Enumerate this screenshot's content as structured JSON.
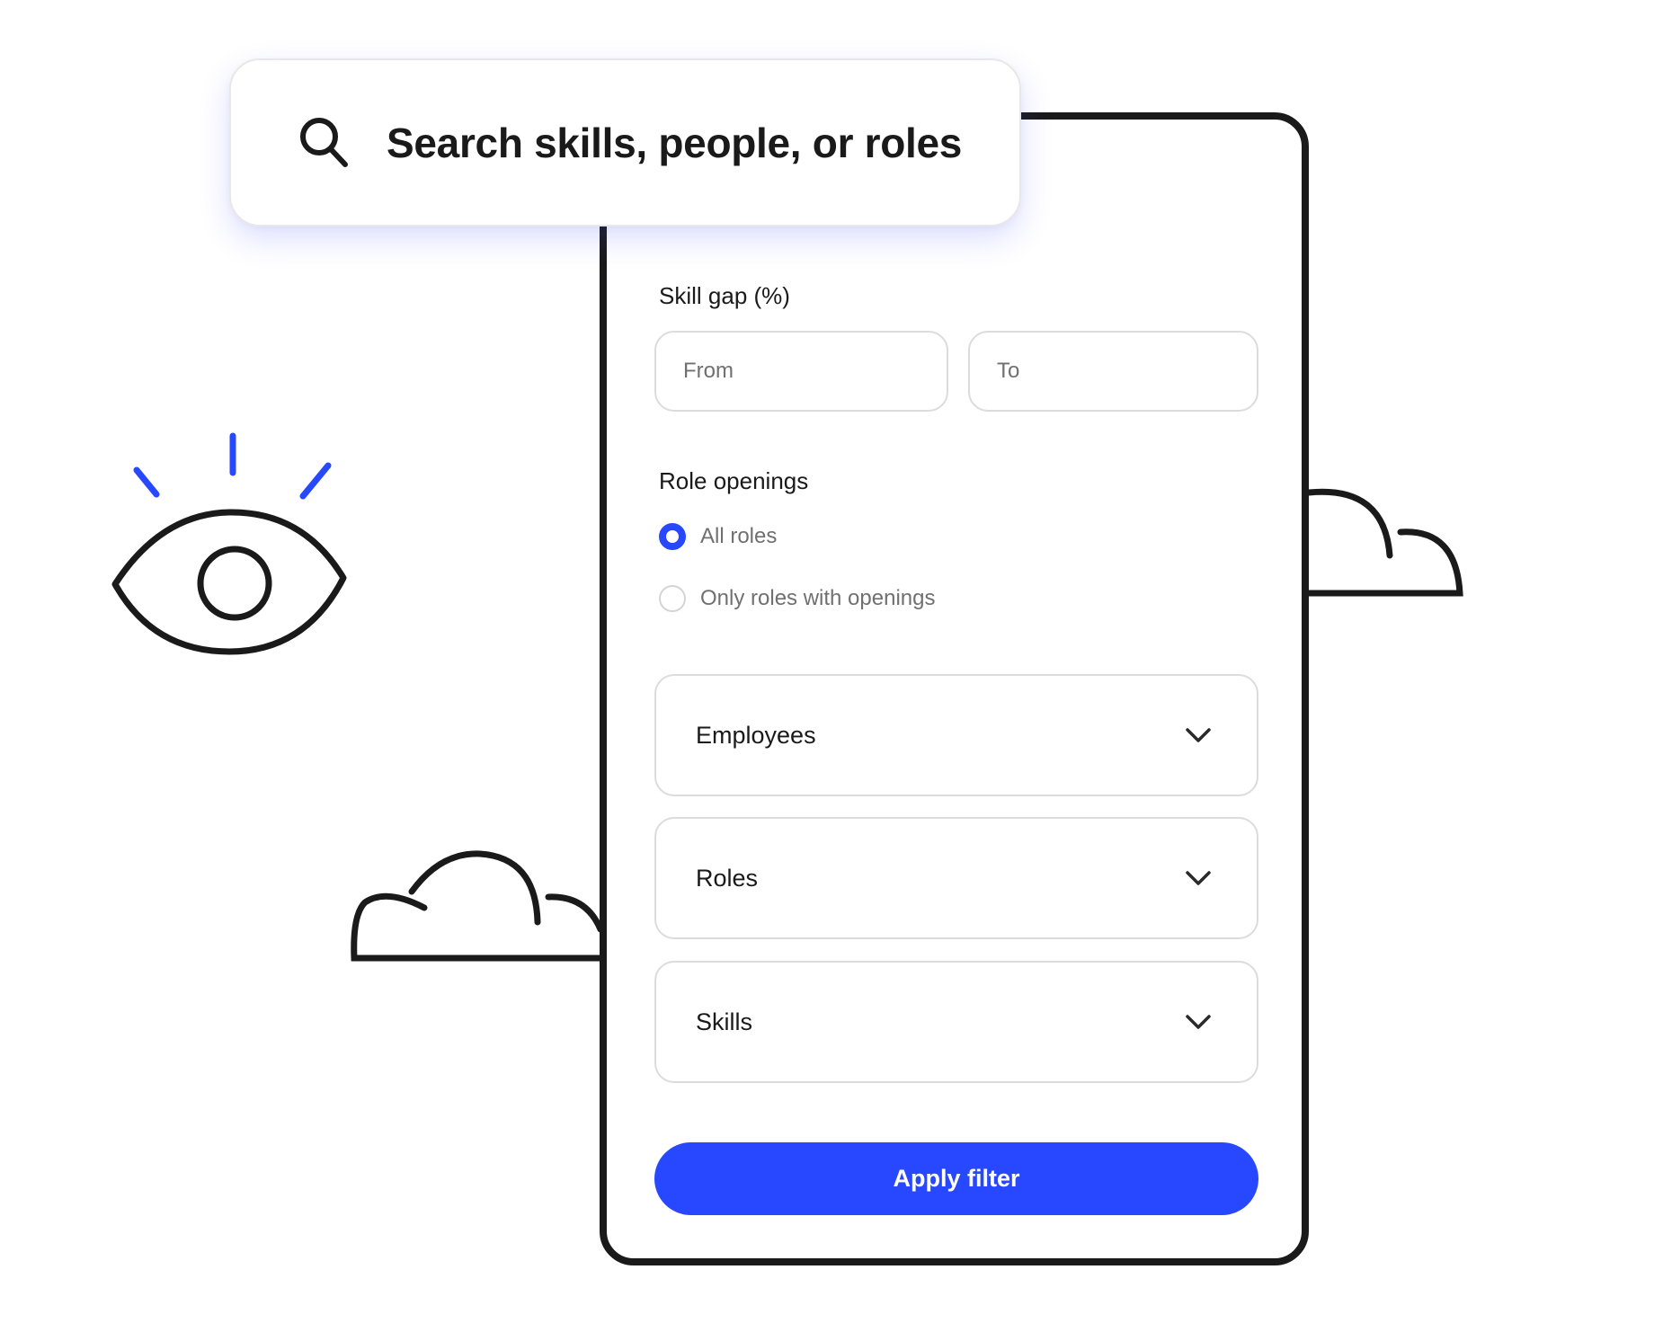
{
  "search": {
    "placeholder": "Search skills, people, or roles",
    "icon": "search-icon"
  },
  "filter": {
    "skill_gap": {
      "label": "Skill gap (%)",
      "from_placeholder": "From",
      "to_placeholder": "To"
    },
    "role_openings": {
      "label": "Role openings",
      "options": [
        {
          "label": "All roles",
          "selected": true
        },
        {
          "label": "Only roles with openings",
          "selected": false
        }
      ]
    },
    "dropdowns": [
      {
        "label": "Employees",
        "icon": "chevron-down-icon"
      },
      {
        "label": "Roles",
        "icon": "chevron-down-icon"
      },
      {
        "label": "Skills",
        "icon": "chevron-down-icon"
      }
    ],
    "apply_label": "Apply filter"
  },
  "colors": {
    "accent": "#2848ff",
    "outline": "#1a1a1a",
    "muted_text": "#707070",
    "field_border": "#dcdcdc"
  },
  "decorations": [
    "eye-icon",
    "cloud-icon",
    "cloud-icon"
  ]
}
